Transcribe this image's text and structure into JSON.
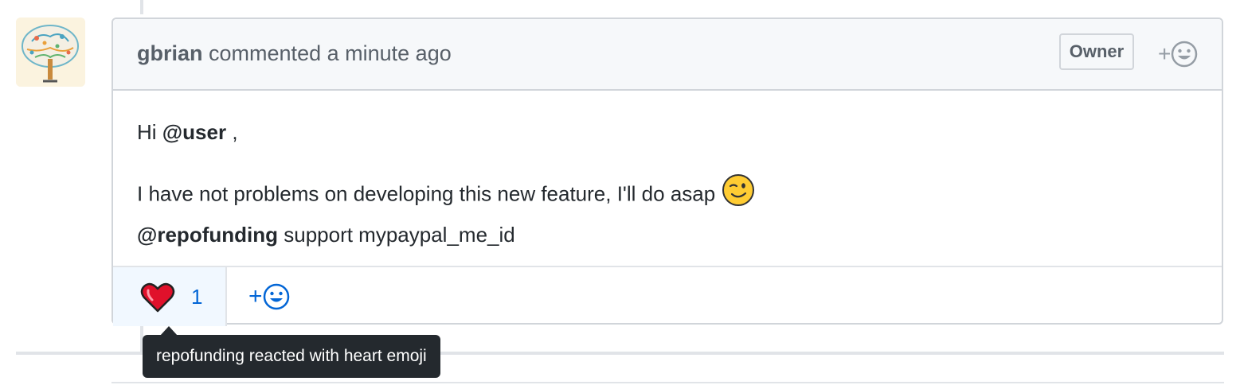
{
  "comment": {
    "author": "gbrian",
    "action_text": "commented",
    "time_text": "a minute ago",
    "badge": "Owner",
    "body": {
      "greeting": "Hi",
      "mention_user": "@user",
      "greeting_tail": ",",
      "line2": "I have not problems on developing this new feature, I'll do asap",
      "mention_repofunding": "@repofunding",
      "line3_tail": "support mypaypal_me_id"
    },
    "reactions": [
      {
        "emoji": "heart",
        "count": "1"
      }
    ],
    "add_reaction_label": "+"
  },
  "tooltip": {
    "text": "repofunding reacted with heart emoji"
  },
  "icons": {
    "header_add_reaction": "smiley-icon",
    "footer_add_reaction": "smiley-icon",
    "heart": "heart-icon",
    "wink": "wink-emoji-icon",
    "avatar": "brain-tree-avatar"
  },
  "colors": {
    "link_blue": "#0366d6",
    "header_bg": "#f6f8fa",
    "reaction_bg": "#f1f8ff",
    "tooltip_bg": "#24292e",
    "heart_red": "#e0112b"
  }
}
